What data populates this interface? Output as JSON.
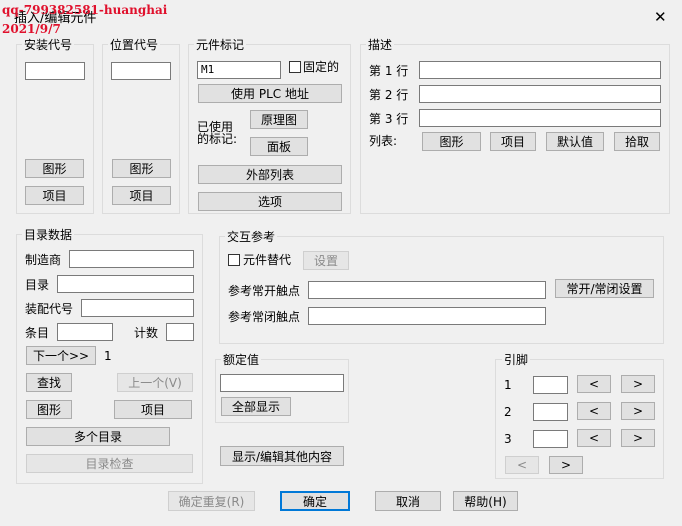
{
  "watermark": {
    "line1": "qq-799382581-huanghai",
    "line2": "2021/9/7"
  },
  "window": {
    "title": "插入/编辑元件",
    "close_glyph": "✕"
  },
  "install": {
    "title": "安装代号",
    "value": "",
    "graphic_btn": "图形",
    "item_btn": "项目"
  },
  "location": {
    "title": "位置代号",
    "value": "",
    "graphic_btn": "图形",
    "item_btn": "项目"
  },
  "tag": {
    "title": "元件标记",
    "value": "M1",
    "fixed_label": "固定的",
    "fixed_checked": false,
    "plc_btn": "使用 PLC 地址",
    "used_label_l1": "已使用",
    "used_label_l2": "的标记:",
    "schematic_btn": "原理图",
    "panel_btn": "面板",
    "external_btn": "外部列表",
    "options_btn": "选项"
  },
  "description": {
    "title": "描述",
    "line1_label": "第 1 行",
    "line2_label": "第 2 行",
    "line3_label": "第 3 行",
    "line1": "",
    "line2": "",
    "line3": "",
    "list_label": "列表:",
    "graphic_btn": "图形",
    "item_btn": "项目",
    "default_btn": "默认值",
    "pick_btn": "拾取"
  },
  "catalog": {
    "title": "目录数据",
    "manufacturer_label": "制造商",
    "catalog_label": "目录",
    "assembly_label": "装配代号",
    "item_label": "条目",
    "count_label": "计数",
    "manufacturer": "",
    "catalog": "",
    "assembly": "",
    "item": "",
    "count": "",
    "next_btn": "下一个>>",
    "next_count": "1",
    "find_btn": "查找",
    "prev_btn": "上一个(V)",
    "graphic_btn": "图形",
    "item_btn": "项目",
    "multi_btn": "多个目录",
    "check_btn": "目录检查"
  },
  "cross_ref": {
    "title": "交互参考",
    "replace_label": "元件替代",
    "replace_checked": false,
    "settings_btn": "设置",
    "no_label": "参考常开触点",
    "nc_label": "参考常闭触点",
    "no_value": "",
    "nc_value": "",
    "no_nc_btn": "常开/常闭设置"
  },
  "rating": {
    "title": "额定值",
    "value": "",
    "show_all_btn": "全部显示"
  },
  "show_edit_btn": "显示/编辑其他内容",
  "pins": {
    "title": "引脚",
    "rows": [
      {
        "label": "1"
      },
      {
        "label": "2"
      },
      {
        "label": "3"
      }
    ],
    "left": "<",
    "right": ">"
  },
  "footer": {
    "confirm_repeat": "确定重复(R)",
    "ok": "确定",
    "cancel": "取消",
    "help": "帮助(H)"
  }
}
